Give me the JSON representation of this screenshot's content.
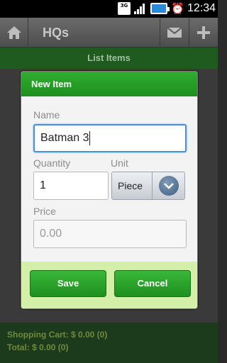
{
  "status_bar": {
    "network": "3G",
    "time": "12:34",
    "icons": [
      "3g-icon",
      "signal-icon",
      "battery-icon",
      "alarm-icon"
    ]
  },
  "action_bar": {
    "title": "HQs",
    "icons": [
      "home-icon",
      "mail-icon",
      "add-icon"
    ]
  },
  "subheader": {
    "title": "List Items"
  },
  "dialog": {
    "title": "New Item",
    "name": {
      "label": "Name",
      "value": "Batman 3"
    },
    "quantity": {
      "label": "Quantity",
      "value": "1"
    },
    "unit": {
      "label": "Unit",
      "value": "Piece"
    },
    "price": {
      "label": "Price",
      "placeholder": "0.00"
    },
    "save_label": "Save",
    "cancel_label": "Cancel"
  },
  "footer": {
    "shopping_cart": "Shopping Cart: $ 0.00 (0)",
    "total": "Total: $ 0.00 (0)"
  },
  "colors": {
    "accent_green": "#1e8f1e",
    "dialog_footer": "#d4f0a8",
    "focus_blue": "#4a90e2"
  }
}
